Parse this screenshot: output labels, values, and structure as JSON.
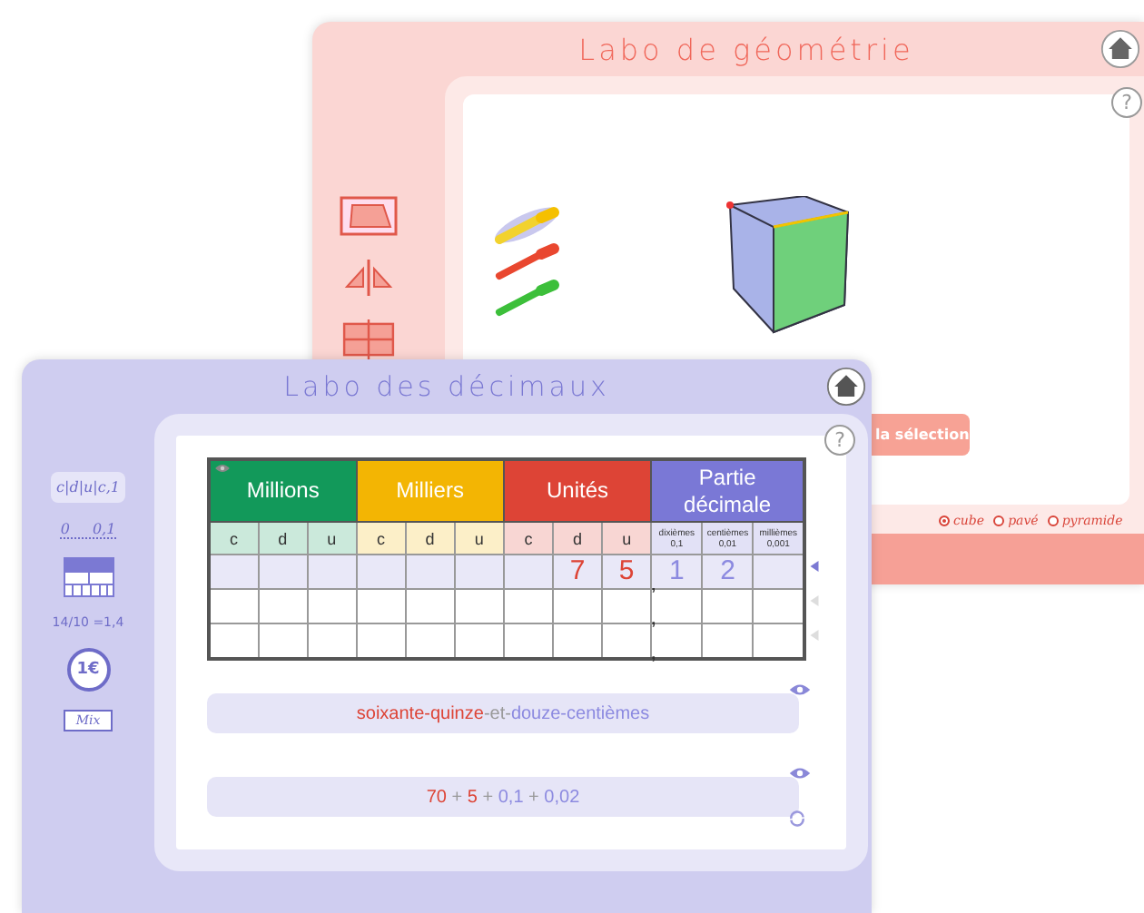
{
  "geometry_window": {
    "title": "Labo de géométrie",
    "help": "?",
    "button": "la sélection",
    "shapes": [
      {
        "label": "cube",
        "selected": true
      },
      {
        "label": "pavé",
        "selected": false
      },
      {
        "label": "pyramide",
        "selected": false
      }
    ]
  },
  "decimals_window": {
    "title": "Labo des décimaux",
    "help": "?",
    "tools": [
      {
        "kind": "abacus",
        "text": "c|d|u|c,1"
      },
      {
        "kind": "ruler",
        "text": "0 0,1"
      },
      {
        "kind": "blocks"
      },
      {
        "kind": "fraction",
        "text": "14/10 =1,4"
      },
      {
        "kind": "coin",
        "text": "1€"
      },
      {
        "kind": "label",
        "text": "Mix"
      }
    ],
    "table": {
      "groups": [
        {
          "label": "Millions",
          "color": "#12995a",
          "columns": [
            {
              "text": "c"
            },
            {
              "text": "d"
            },
            {
              "text": "u"
            }
          ]
        },
        {
          "label": "Milliers",
          "color": "#f3b503",
          "columns": [
            {
              "text": "c"
            },
            {
              "text": "d"
            },
            {
              "text": "u"
            }
          ]
        },
        {
          "label": "Unités",
          "color": "#dd4436",
          "columns": [
            {
              "text": "c"
            },
            {
              "text": "d"
            },
            {
              "text": "u"
            }
          ]
        },
        {
          "label": "Partie décimale",
          "color": "#7a78d6",
          "columns": [
            {
              "text": "dixièmes",
              "sub": "0,1"
            },
            {
              "text": "centièmes",
              "sub": "0,01"
            },
            {
              "text": "millièmes",
              "sub": "0,001"
            }
          ]
        }
      ],
      "rows": [
        {
          "selected": true,
          "separator": ",",
          "cells": [
            "",
            "",
            "",
            "",
            "",
            "",
            "",
            "7",
            "5",
            "1",
            "2",
            ""
          ]
        },
        {
          "selected": false,
          "separator": ",",
          "cells": [
            "",
            "",
            "",
            "",
            "",
            "",
            "",
            "",
            "",
            "",
            "",
            ""
          ]
        },
        {
          "selected": false,
          "separator": ",",
          "cells": [
            "",
            "",
            "",
            "",
            "",
            "",
            "",
            "",
            "",
            "",
            "",
            ""
          ]
        }
      ]
    },
    "strips": [
      {
        "parts": [
          {
            "text": "soixante-quinze",
            "kind": "integer"
          },
          {
            "text": "-et-",
            "kind": "link"
          },
          {
            "text": "douze-centièmes",
            "kind": "decimal"
          }
        ]
      },
      {
        "parts": [
          {
            "text": "70",
            "kind": "integer"
          },
          {
            "text": " + ",
            "kind": "link"
          },
          {
            "text": "5",
            "kind": "integer"
          },
          {
            "text": " + ",
            "kind": "link"
          },
          {
            "text": "0,1",
            "kind": "decimal"
          },
          {
            "text": " + ",
            "kind": "link"
          },
          {
            "text": "0,02",
            "kind": "decimal"
          }
        ]
      }
    ]
  }
}
